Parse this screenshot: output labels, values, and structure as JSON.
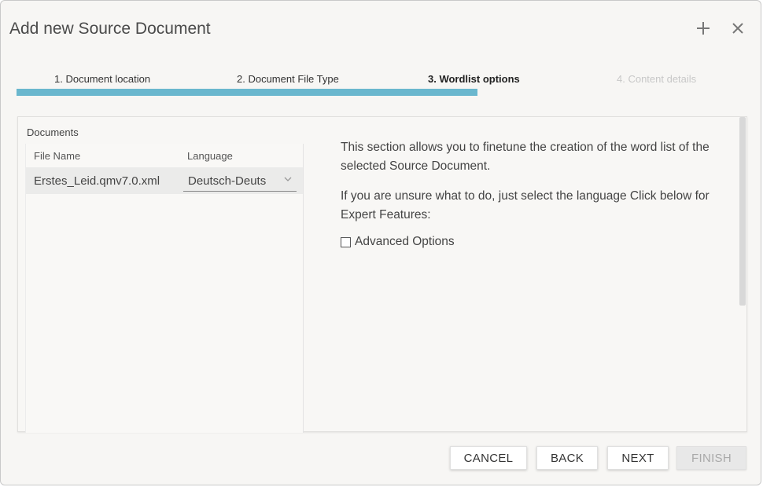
{
  "dialog": {
    "title": "Add new Source Document"
  },
  "icons": {
    "add": "plus-icon",
    "close": "close-icon",
    "dropdown": "chevron-down-icon"
  },
  "steps": [
    {
      "label": "1. Document location",
      "state": "done"
    },
    {
      "label": "2. Document File Type",
      "state": "done"
    },
    {
      "label": "3. Wordlist options",
      "state": "current"
    },
    {
      "label": "4. Content details",
      "state": "disabled"
    }
  ],
  "progress": {
    "completed_fraction": 0.63,
    "color": "#6ab7ce"
  },
  "documents": {
    "section_label": "Documents",
    "columns": [
      "File Name",
      "Language"
    ],
    "rows": [
      {
        "file_name": "Erstes_Leid.qmv7.0.xml",
        "language": "Deutsch-Deuts"
      }
    ]
  },
  "info": {
    "paragraph1": "This section allows you to finetune the creation of the word list of the selected Source Document.",
    "paragraph2": "If you are unsure what to do, just select the language Click below for Expert Features:",
    "advanced_label": "Advanced Options",
    "advanced_checked": false
  },
  "buttons": {
    "cancel": "CANCEL",
    "back": "BACK",
    "next": "NEXT",
    "finish": "FINISH"
  }
}
